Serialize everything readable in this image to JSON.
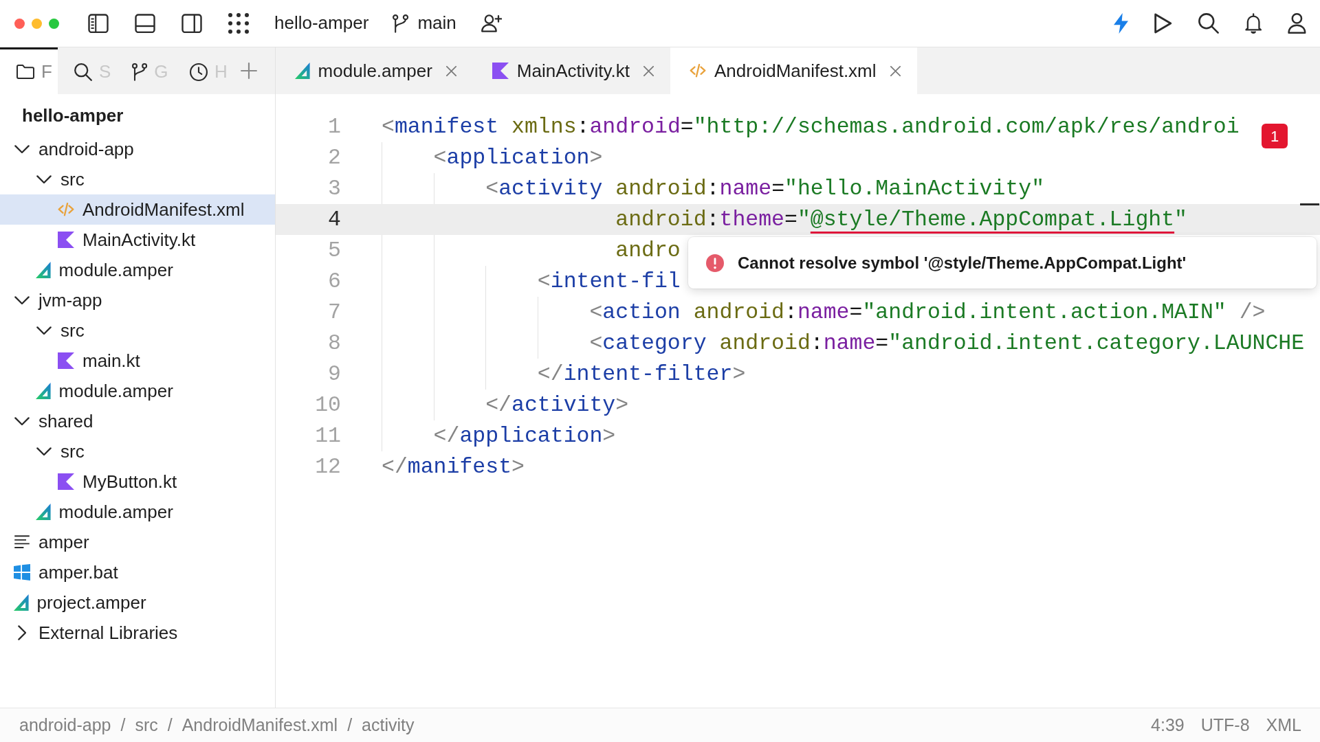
{
  "toolbar": {
    "project": "hello-amper",
    "branch": "main"
  },
  "tool_tabs": [
    {
      "label": "F",
      "kind": "folder",
      "selected": true
    },
    {
      "label": "S",
      "kind": "search",
      "selected": false
    },
    {
      "label": "G",
      "kind": "branch",
      "selected": false
    },
    {
      "label": "H",
      "kind": "clock",
      "selected": false
    }
  ],
  "editor_tabs": [
    {
      "label": "module.amper",
      "kind": "amper",
      "selected": false
    },
    {
      "label": "MainActivity.kt",
      "kind": "kotlin",
      "selected": false
    },
    {
      "label": "AndroidManifest.xml",
      "kind": "xml",
      "selected": true
    }
  ],
  "project_tree": {
    "title": "hello-amper",
    "items": [
      {
        "label": "android-app",
        "kind": "folder",
        "expanded": true,
        "selected": false,
        "children": [
          {
            "label": "src",
            "kind": "folder",
            "expanded": true,
            "selected": false,
            "children": [
              {
                "label": "AndroidManifest.xml",
                "kind": "xml",
                "selected": true
              },
              {
                "label": "MainActivity.kt",
                "kind": "kotlin",
                "selected": false
              }
            ]
          },
          {
            "label": "module.amper",
            "kind": "amper",
            "selected": false
          }
        ]
      },
      {
        "label": "jvm-app",
        "kind": "folder",
        "expanded": true,
        "selected": false,
        "children": [
          {
            "label": "src",
            "kind": "folder",
            "expanded": true,
            "selected": false,
            "children": [
              {
                "label": "main.kt",
                "kind": "kotlin",
                "selected": false
              }
            ]
          },
          {
            "label": "module.amper",
            "kind": "amper",
            "selected": false
          }
        ]
      },
      {
        "label": "shared",
        "kind": "folder",
        "expanded": true,
        "selected": false,
        "children": [
          {
            "label": "src",
            "kind": "folder",
            "expanded": true,
            "selected": false,
            "children": [
              {
                "label": "MyButton.kt",
                "kind": "kotlin",
                "selected": false
              }
            ]
          },
          {
            "label": "module.amper",
            "kind": "amper",
            "selected": false
          }
        ]
      },
      {
        "label": "amper",
        "kind": "script",
        "selected": false
      },
      {
        "label": "amper.bat",
        "kind": "batch",
        "selected": false
      },
      {
        "label": "project.amper",
        "kind": "amper",
        "selected": false
      },
      {
        "label": "External Libraries",
        "kind": "folder",
        "expanded": false,
        "selected": false
      }
    ]
  },
  "editor": {
    "error_count": "1",
    "lines": [
      {
        "number": "1",
        "current": false,
        "code": [
          {
            "kind": "bracket",
            "text": "<"
          },
          {
            "kind": "tag",
            "text": "manifest"
          },
          {
            "kind": "ns",
            "text": " xmlns"
          },
          {
            "kind": "punct",
            "text": ":"
          },
          {
            "kind": "attr",
            "text": "android"
          },
          {
            "kind": "punct",
            "text": "="
          },
          {
            "kind": "string",
            "text": "\"http://schemas.android.com/apk/res/androi"
          }
        ]
      },
      {
        "number": "2",
        "current": false,
        "code": [
          {
            "kind": "bracket",
            "text": "    <"
          },
          {
            "kind": "tag",
            "text": "application"
          },
          {
            "kind": "bracket",
            "text": ">"
          }
        ]
      },
      {
        "number": "3",
        "current": false,
        "code": [
          {
            "kind": "bracket",
            "text": "        <"
          },
          {
            "kind": "tag",
            "text": "activity"
          },
          {
            "kind": "ns",
            "text": " android"
          },
          {
            "kind": "punct",
            "text": ":"
          },
          {
            "kind": "attr",
            "text": "name"
          },
          {
            "kind": "punct",
            "text": "="
          },
          {
            "kind": "string",
            "text": "\"hello.MainActivity\""
          }
        ]
      },
      {
        "number": "4",
        "current": true,
        "code": [
          {
            "kind": "ns",
            "text": "                  android"
          },
          {
            "kind": "punct",
            "text": ":"
          },
          {
            "kind": "attr",
            "text": "theme"
          },
          {
            "kind": "punct",
            "text": "="
          },
          {
            "kind": "string",
            "text": "\""
          },
          {
            "kind": "invalid",
            "text": "@style/Theme.AppCompat.Light"
          },
          {
            "kind": "string",
            "text": "\""
          }
        ]
      },
      {
        "number": "5",
        "current": false,
        "code": [
          {
            "kind": "ns",
            "text": "                  andro"
          }
        ]
      },
      {
        "number": "6",
        "current": false,
        "code": [
          {
            "kind": "bracket",
            "text": "            <"
          },
          {
            "kind": "tag",
            "text": "intent-fil"
          }
        ]
      },
      {
        "number": "7",
        "current": false,
        "code": [
          {
            "kind": "bracket",
            "text": "                <"
          },
          {
            "kind": "tag",
            "text": "action"
          },
          {
            "kind": "ns",
            "text": " android"
          },
          {
            "kind": "punct",
            "text": ":"
          },
          {
            "kind": "attr",
            "text": "name"
          },
          {
            "kind": "punct",
            "text": "="
          },
          {
            "kind": "string",
            "text": "\"android.intent.action.MAIN\""
          },
          {
            "kind": "bracket",
            "text": " />"
          }
        ]
      },
      {
        "number": "8",
        "current": false,
        "code": [
          {
            "kind": "bracket",
            "text": "                <"
          },
          {
            "kind": "tag",
            "text": "category"
          },
          {
            "kind": "ns",
            "text": " android"
          },
          {
            "kind": "punct",
            "text": ":"
          },
          {
            "kind": "attr",
            "text": "name"
          },
          {
            "kind": "punct",
            "text": "="
          },
          {
            "kind": "string",
            "text": "\"android.intent.category.LAUNCHE"
          }
        ]
      },
      {
        "number": "9",
        "current": false,
        "code": [
          {
            "kind": "bracket",
            "text": "            </"
          },
          {
            "kind": "tag",
            "text": "intent-filter"
          },
          {
            "kind": "bracket",
            "text": ">"
          }
        ]
      },
      {
        "number": "10",
        "current": false,
        "code": [
          {
            "kind": "bracket",
            "text": "        </"
          },
          {
            "kind": "tag",
            "text": "activity"
          },
          {
            "kind": "bracket",
            "text": ">"
          }
        ]
      },
      {
        "number": "11",
        "current": false,
        "code": [
          {
            "kind": "bracket",
            "text": "    </"
          },
          {
            "kind": "tag",
            "text": "application"
          },
          {
            "kind": "bracket",
            "text": ">"
          }
        ]
      },
      {
        "number": "12",
        "current": false,
        "code": [
          {
            "kind": "bracket",
            "text": "</"
          },
          {
            "kind": "tag",
            "text": "manifest"
          },
          {
            "kind": "bracket",
            "text": ">"
          }
        ]
      }
    ],
    "popup": {
      "message": "Cannot resolve symbol '@style/Theme.AppCompat.Light'"
    }
  },
  "status_bar": {
    "breadcrumbs": [
      {
        "text": "android-app",
        "separator": "/"
      },
      {
        "text": "src",
        "separator": "/"
      },
      {
        "text": "AndroidManifest.xml",
        "separator": "/"
      },
      {
        "text": "activity"
      }
    ],
    "caret_position": "4:39",
    "encoding": "UTF-8",
    "file_type": "XML"
  }
}
